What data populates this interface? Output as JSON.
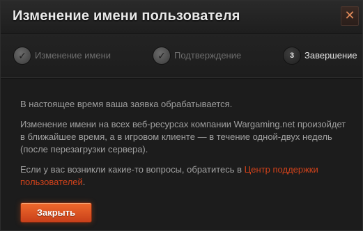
{
  "dialog": {
    "title": "Изменение имени пользователя",
    "close_icon": "✕"
  },
  "steps": [
    {
      "label": "Изменение имени",
      "marker": "✓",
      "icon": "check-icon",
      "state": "done"
    },
    {
      "label": "Подтверждение",
      "marker": "✓",
      "icon": "check-icon",
      "state": "done"
    },
    {
      "label": "Завершение",
      "marker": "3",
      "state": "active"
    }
  ],
  "body": {
    "p1": "В настоящее время ваша заявка обрабатывается.",
    "p2": "Изменение имени на всех веб-ресурсах компании Wargaming.net произойдет в ближайшее время, а в игровом клиенте — в течение одной-двух недель (после перезагрузки сервера).",
    "p3_text": "Если у вас возникли какие-то вопросы, обратитесь в ",
    "p3_link": "Центр поддержки пользователей",
    "p3_end": "."
  },
  "button": {
    "label": "Закрыть"
  },
  "colors": {
    "accent": "#e8562a",
    "link": "#d0421b"
  }
}
